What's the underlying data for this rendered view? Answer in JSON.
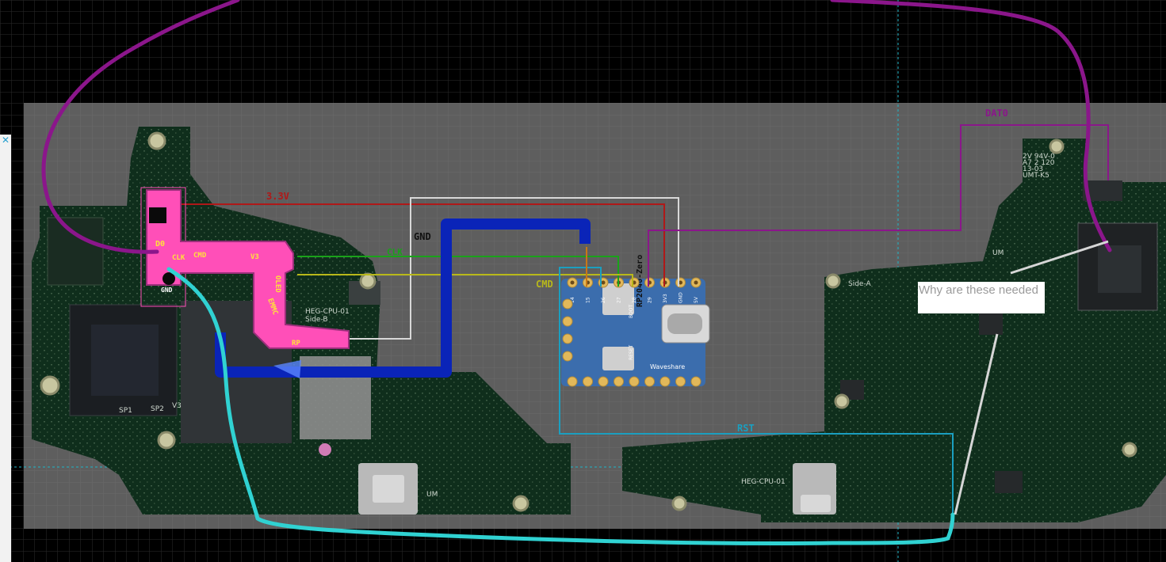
{
  "diagram": {
    "wire_labels": {
      "v33": "3.3V",
      "gnd": "GND",
      "clk": "CLK",
      "cmd": "CMD",
      "dat0": "DAT0",
      "rst": "RST"
    },
    "flex_labels": {
      "d0": "D0",
      "clk": "CLK",
      "cmd": "CMD",
      "v3": "V3",
      "gnd": "GND",
      "oled": "OLED",
      "emmc": "EMMC",
      "rp": "RP"
    },
    "silkscreen": {
      "board_left": "HEG-CPU-01",
      "side_b": "Side-B",
      "side_a": "Side-A",
      "board_right": "HEG-CPU-01",
      "um_left": "UM",
      "um_right": "UM",
      "v3_mark": "V3",
      "sp1": "SP1",
      "sp2": "SP2",
      "cert": "2V 94V-0\nA7 2 120\n13-03\nUMT-K5"
    },
    "rp2040": {
      "chip": "RP2040-Zero",
      "brand": "Waveshare",
      "boot": "BOOT",
      "reset": "RESET",
      "pins_top": [
        "14",
        "15",
        "26",
        "27",
        "28",
        "29",
        "3V3",
        "GND",
        "5V"
      ]
    },
    "annotation": "Why are these needed",
    "colors": {
      "v33": "#b01818",
      "gnd": "#d8d8d8",
      "clk": "#1aa21a",
      "cmd": "#b8b81a",
      "dat0": "#8a178a",
      "rst": "#1b9fc0",
      "flex": "#ff4fb8",
      "purple_marker": "#8b168b",
      "cyan_marker": "#30d2d2",
      "blue_marker": "#0a24b8",
      "board": "#0f2e1c"
    }
  }
}
